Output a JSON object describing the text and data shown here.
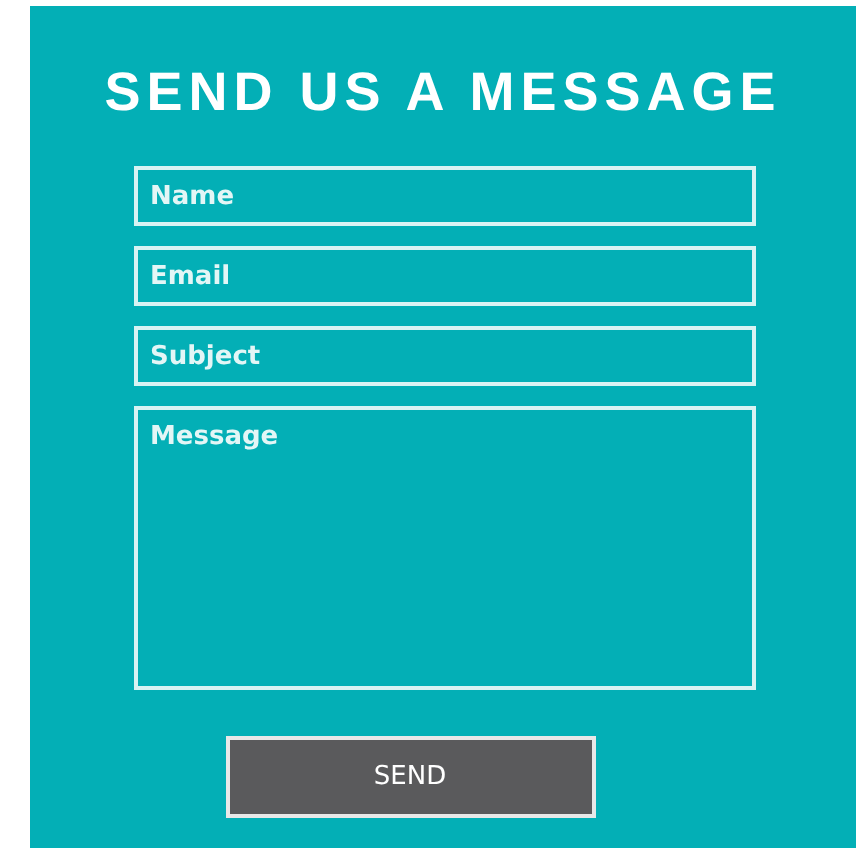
{
  "title": "SEND US A MESSAGE",
  "fields": [
    {
      "kind": "line",
      "placeholder": "Name"
    },
    {
      "kind": "line",
      "placeholder": "Email"
    },
    {
      "kind": "line",
      "placeholder": "Subject"
    },
    {
      "kind": "area",
      "placeholder": "Message"
    }
  ],
  "button": {
    "label": "SEND"
  }
}
